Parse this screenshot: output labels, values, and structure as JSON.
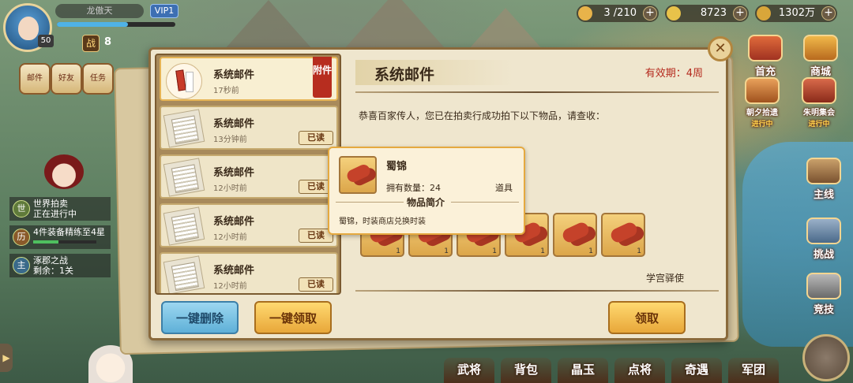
{
  "hud": {
    "player_name": "龙傲天",
    "vip": "VIP1",
    "level": "50",
    "power_prefix": "8",
    "resources": [
      {
        "icon": "stamina-icon",
        "value": "3 /210",
        "color": "#e8b34a"
      },
      {
        "icon": "gold-ingot-icon",
        "value": "8723",
        "color": "#e8c24a"
      },
      {
        "icon": "coin-icon",
        "value": "1302万",
        "color": "#d9a63a"
      }
    ]
  },
  "left_icons": [
    "邮件",
    "好友",
    "任务"
  ],
  "events": [
    {
      "tag": "世",
      "line1": "世界拍卖",
      "line2": "正在进行中"
    },
    {
      "tag": "历",
      "line1": "4件装备精练至4星",
      "line2": ""
    },
    {
      "tag": "主",
      "line1": "涿郡之战",
      "line2": "剩余：1关"
    }
  ],
  "right_icons": [
    {
      "label": "首充",
      "sub": ""
    },
    {
      "label": "商城",
      "sub": ""
    },
    {
      "label": "朝夕拾遗",
      "sub": "进行中"
    },
    {
      "label": "朱明集会",
      "sub": "进行中"
    },
    {
      "label": "主线",
      "sub": ""
    },
    {
      "label": "挑战",
      "sub": ""
    },
    {
      "label": "竞技",
      "sub": ""
    }
  ],
  "bottom_tabs": [
    "武将",
    "背包",
    "晶玉",
    "点将",
    "奇遇",
    "军团"
  ],
  "mail": {
    "items": [
      {
        "title": "系统邮件",
        "time": "17秒前",
        "badge": "附件",
        "type": "attach"
      },
      {
        "title": "系统邮件",
        "time": "13分钟前",
        "badge": "已读",
        "type": "read"
      },
      {
        "title": "系统邮件",
        "time": "12小时前",
        "badge": "已读",
        "type": "read"
      },
      {
        "title": "系统邮件",
        "time": "12小时前",
        "badge": "已读",
        "type": "read"
      },
      {
        "title": "系统邮件",
        "time": "12小时前",
        "badge": "已读",
        "type": "read"
      }
    ],
    "delete_all_label": "一键删除",
    "claim_all_label": "一键领取",
    "detail": {
      "title": "系统邮件",
      "expire": "有效期：4周",
      "body": "恭喜百家传人，您已在拍卖行成功拍下以下物品，请查收：",
      "sender": "学宫驿使",
      "claim_label": "领取",
      "rewards": [
        {
          "count": "1"
        },
        {
          "count": "1"
        },
        {
          "count": "1"
        },
        {
          "count": "1"
        },
        {
          "count": "1"
        },
        {
          "count": "1"
        }
      ]
    }
  },
  "tooltip": {
    "name": "蜀锦",
    "owned": "拥有数量：24",
    "type": "道具",
    "section": "物品简介",
    "desc": "蜀锦，时装商店兑换时装"
  }
}
